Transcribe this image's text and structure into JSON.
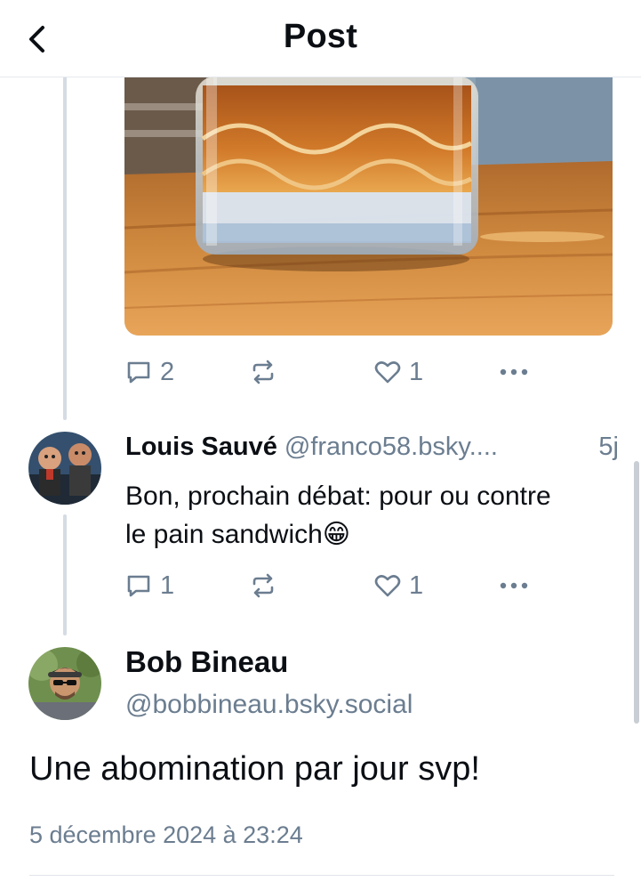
{
  "header": {
    "title": "Post",
    "back_icon": "chevron-left-icon"
  },
  "colors": {
    "text": "#0b0f14",
    "muted": "#6b7d90",
    "thread_line": "#d5dbe2",
    "divider": "#e6e9ee"
  },
  "parent_post": {
    "image": "whisky-glass-on-wooden-table",
    "actions": {
      "reply_count": "2",
      "repost_count": "",
      "like_count": "1"
    }
  },
  "reply": {
    "author_name": "Louis Sauvé",
    "handle": "@franco58.bsky....",
    "time": "5j",
    "text": "Bon, prochain débat: pour ou contre le pain sandwich😁",
    "actions": {
      "reply_count": "1",
      "repost_count": "",
      "like_count": "1"
    }
  },
  "main_post": {
    "author_name": "Bob Bineau",
    "handle": "@bobbineau.bsky.social",
    "text": "Une abomination par jour svp!",
    "date": "5 décembre 2024 à 23:24"
  }
}
